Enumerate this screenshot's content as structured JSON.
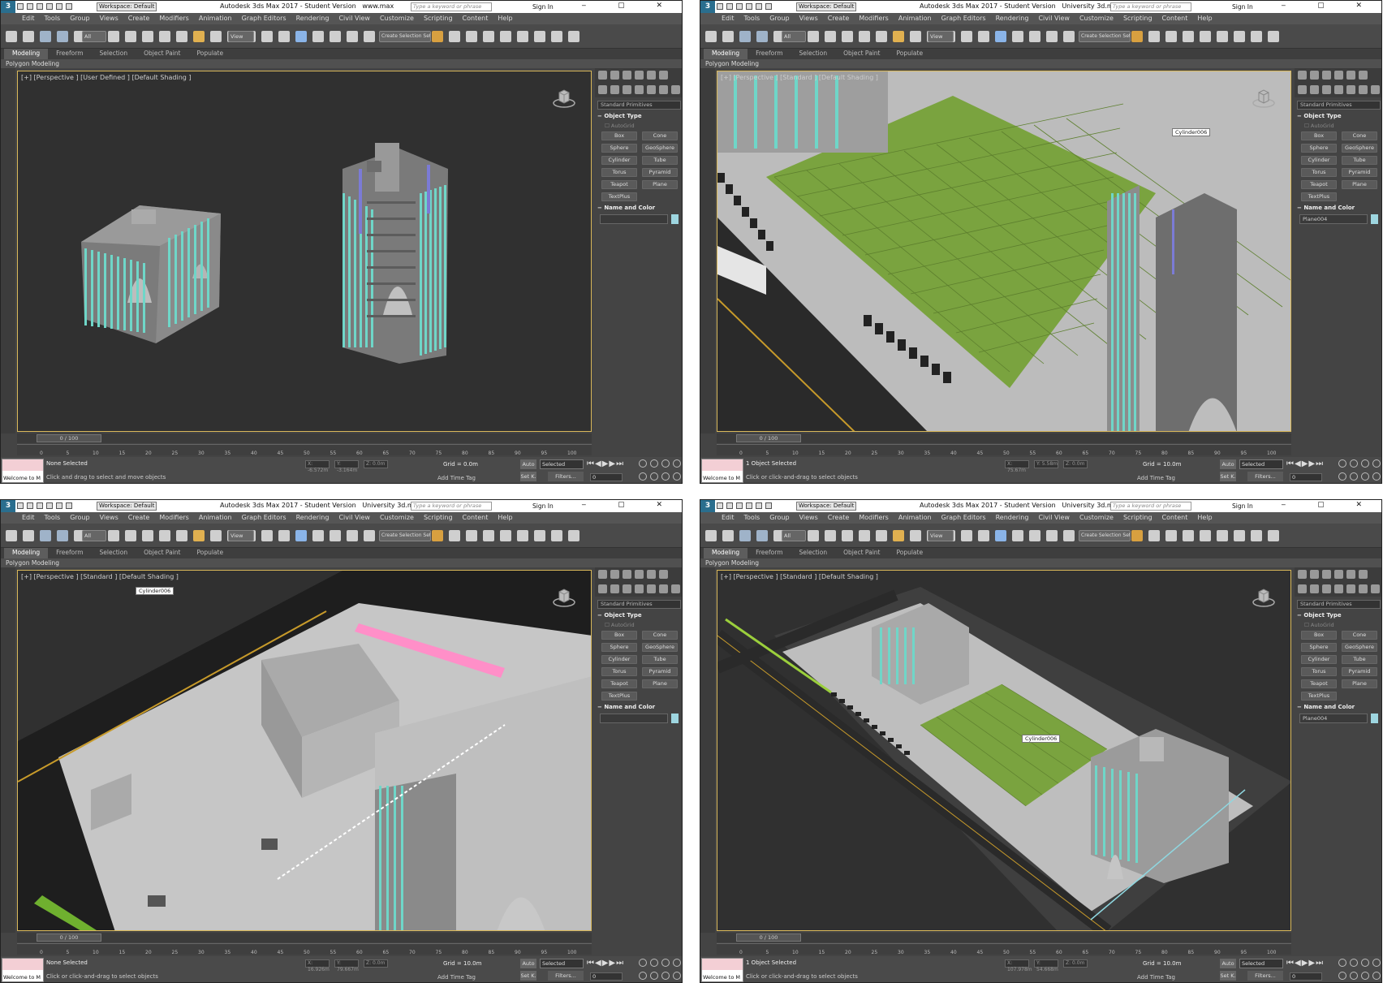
{
  "app": {
    "title_prefix": "Autodesk 3ds Max 2017 - Student Version",
    "workspace": "Workspace: Default",
    "search_placeholder": "Type a keyword or phrase",
    "sign_in": "Sign In",
    "icon_label": "3"
  },
  "menus": [
    "Edit",
    "Tools",
    "Group",
    "Views",
    "Create",
    "Modifiers",
    "Animation",
    "Graph Editors",
    "Rendering",
    "Civil View",
    "Customize",
    "Scripting",
    "Content",
    "Help"
  ],
  "ribbon_tabs": [
    "Modeling",
    "Freeform",
    "Selection",
    "Object Paint",
    "Populate"
  ],
  "polygon_modeling": "Polygon Modeling",
  "command_panel": {
    "category": "Standard Primitives",
    "object_type": "Object Type",
    "autogrid": "AutoGrid",
    "buttons": [
      "Box",
      "Cone",
      "Sphere",
      "GeoSphere",
      "Cylinder",
      "Tube",
      "Torus",
      "Pyramid",
      "Teapot",
      "Plane",
      "TextPlus"
    ],
    "name_and_color": "Name and Color"
  },
  "toolbar": {
    "filter_all": "All",
    "view": "View",
    "create_selection_set": "Create Selection Set"
  },
  "timeline_ticks": [
    "0",
    "5",
    "10",
    "15",
    "20",
    "25",
    "30",
    "35",
    "40",
    "45",
    "50",
    "55",
    "60",
    "65",
    "70",
    "75",
    "80",
    "85",
    "90",
    "95",
    "100"
  ],
  "windows": [
    {
      "file": "www.max",
      "viewport_label": "[+] [Perspective ] [User Defined ] [Default Shading ]",
      "frame": "0 / 100",
      "status_main": "None Selected",
      "status_hint": "Click and drag to select and move objects",
      "grid": "Grid = 0.0m",
      "coords": {
        "x": "X: -6.572m",
        "y": "Y: -3.164m",
        "z": "Z: 0.0m"
      },
      "name_field": "",
      "object_label": "",
      "maxscript": "Welcome to M"
    },
    {
      "file": "University 3d.max",
      "viewport_label": "[+] [Perspective ] [Standard ] [Default Shading ]",
      "frame": "0 / 100",
      "status_main": "1 Object Selected",
      "status_hint": "Click or click-and-drag to select objects",
      "grid": "Grid = 10.0m",
      "coords": {
        "x": "X: 75.67m",
        "y": "Y: 5.58m",
        "z": "Z: 0.0m"
      },
      "name_field": "Plane004",
      "object_label": "Cylinder006",
      "maxscript": "Welcome to M"
    },
    {
      "file": "University 3d.max",
      "viewport_label": "[+] [Perspective ] [Standard ] [Default Shading ]",
      "frame": "0 / 100",
      "status_main": "None Selected",
      "status_hint": "Click or click-and-drag to select objects",
      "grid": "Grid = 10.0m",
      "coords": {
        "x": "X: 16.926m",
        "y": "Y: 79.667m",
        "z": "Z: 0.0m"
      },
      "name_field": "",
      "object_label": "Cylinder006",
      "maxscript": "Welcome to M"
    },
    {
      "file": "University 3d.max",
      "viewport_label": "[+] [Perspective ] [Standard ] [Default Shading ]",
      "frame": "0 / 100",
      "status_main": "1 Object Selected",
      "status_hint": "Click or click-and-drag to select objects",
      "grid": "Grid = 10.0m",
      "coords": {
        "x": "X: 107.978m",
        "y": "Y: 54.668m",
        "z": "Z: 0.0m"
      },
      "name_field": "Plane004",
      "object_label": "Cylinder006",
      "maxscript": "Welcome to M"
    }
  ],
  "status": {
    "add_time_tag": "Add Time Tag",
    "auto": "Auto",
    "selected": "Selected",
    "set_key": "Set K.",
    "filters": "Filters...",
    "frame_value": "0"
  },
  "colors": {
    "viewport_bg": "#303030",
    "grass": "#7aa33f",
    "concrete": "#c9c9c9",
    "teal_columns": "#6fd6c8",
    "selection_border": "#d9b85a",
    "road": "#2a2a2a"
  }
}
